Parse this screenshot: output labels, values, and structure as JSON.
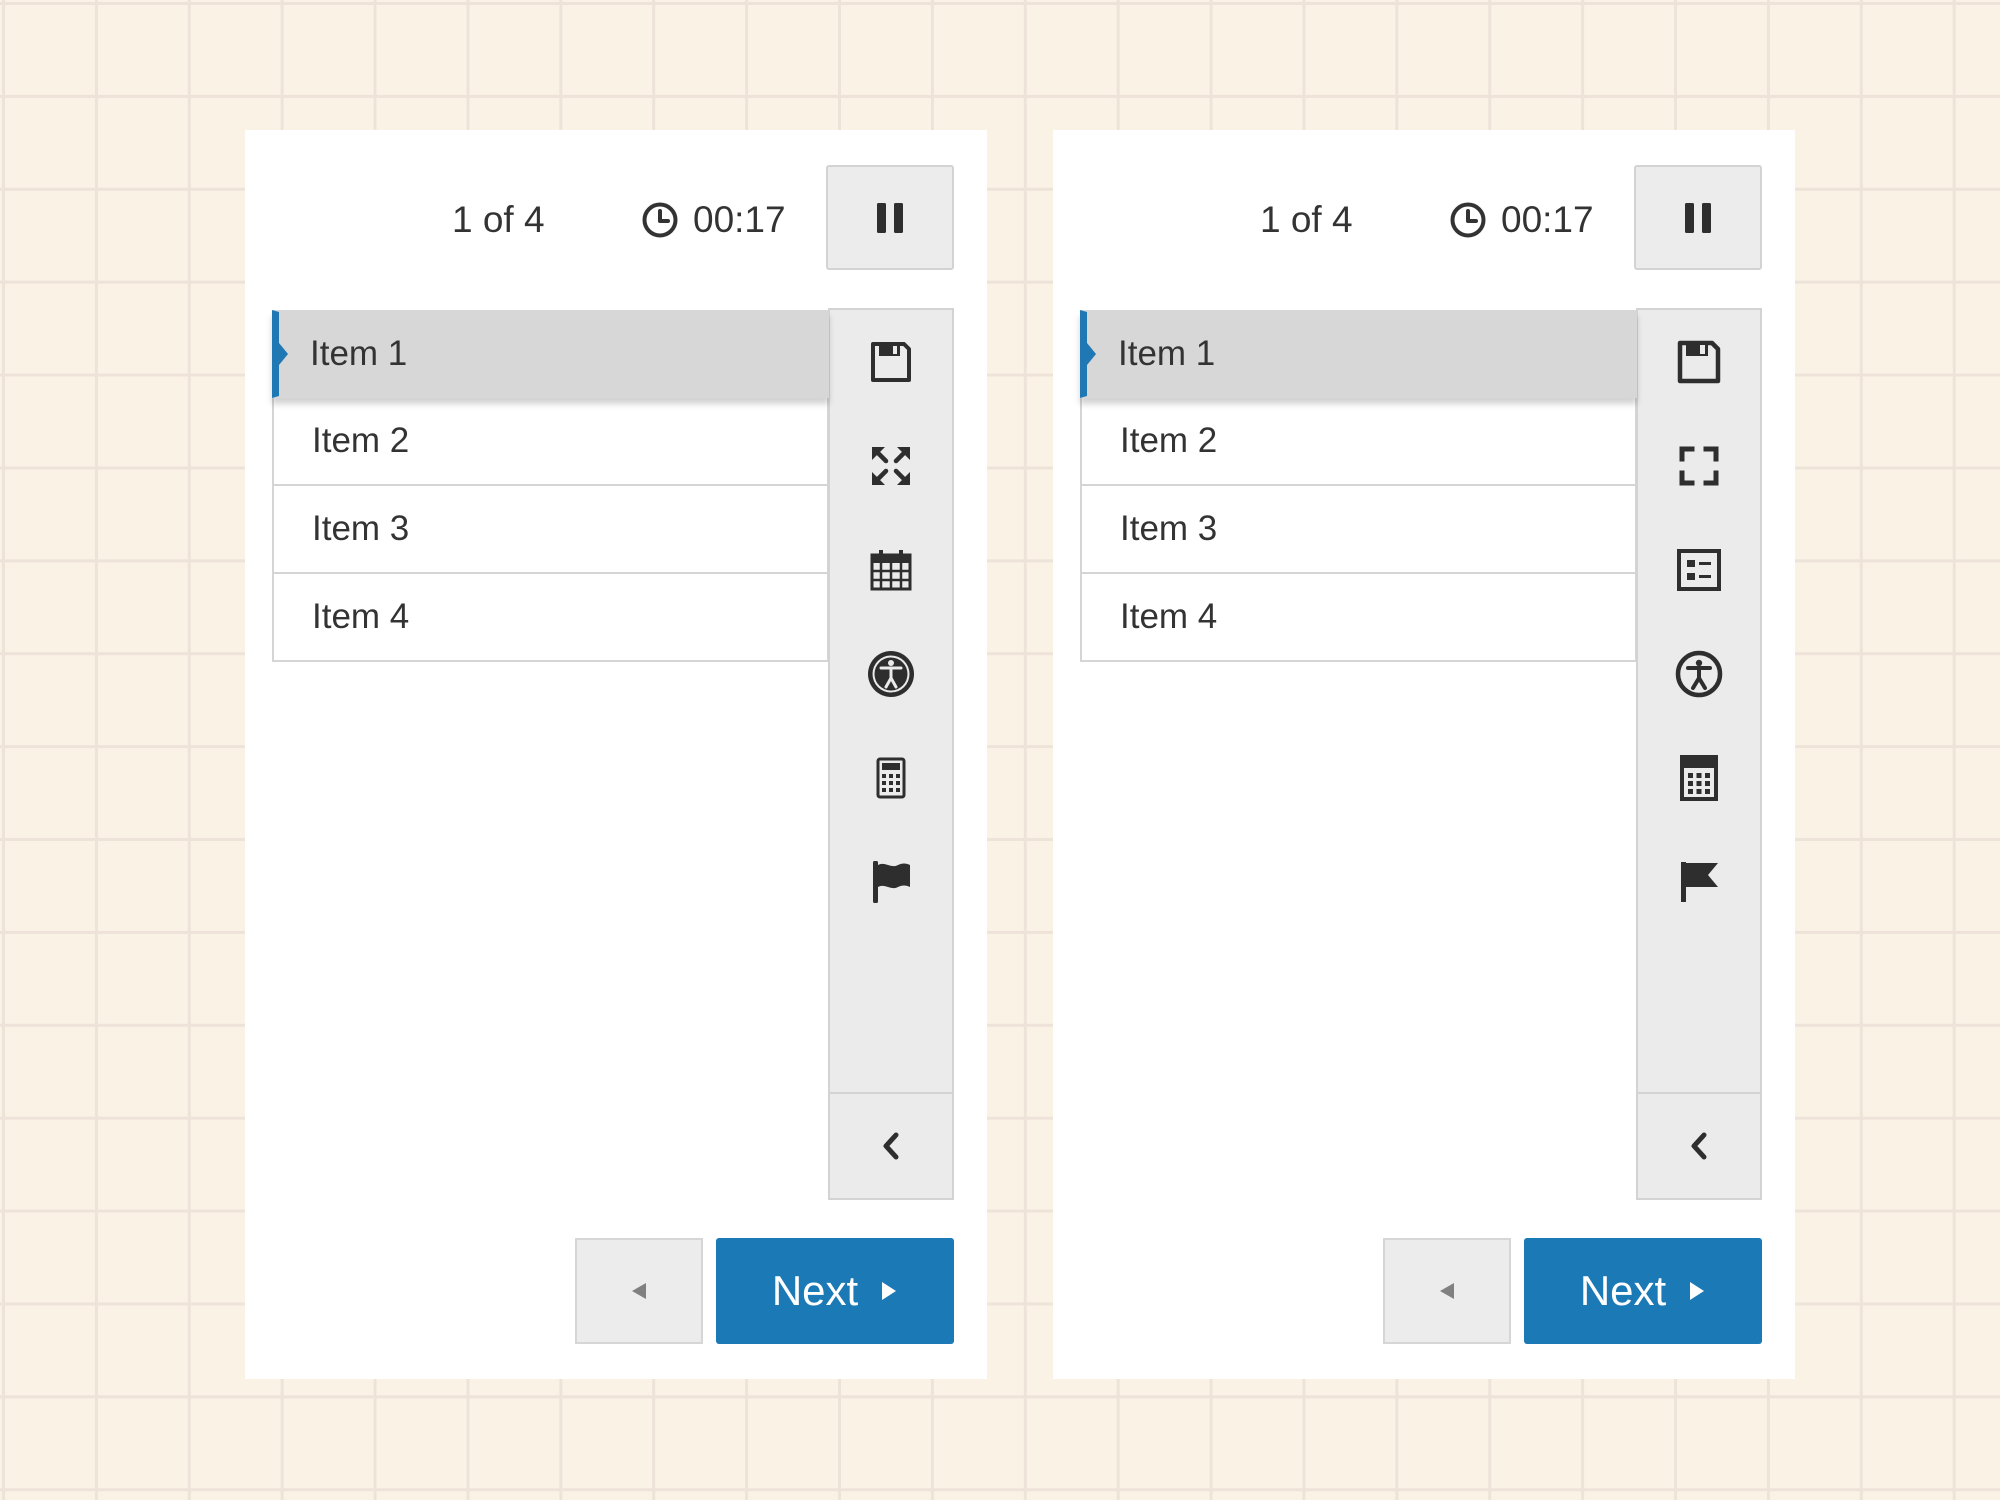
{
  "colors": {
    "accent": "#1b79b6",
    "background": "#fbf2e6",
    "panel": "#ffffff",
    "toolbar": "#ebebeb"
  },
  "panels": [
    {
      "variant": "original",
      "position_label": "1 of 4",
      "timer": "00:17",
      "items": [
        {
          "label": "Item 1",
          "active": true
        },
        {
          "label": "Item 2",
          "active": false
        },
        {
          "label": "Item 3",
          "active": false
        },
        {
          "label": "Item 4",
          "active": false
        }
      ],
      "tools": [
        "save-icon",
        "expand-arrows-icon",
        "calendar-icon",
        "accessibility-icon",
        "calculator-icon",
        "flag-icon"
      ],
      "next_label": "Next"
    },
    {
      "variant": "redesigned",
      "position_label": "1 of 4",
      "timer": "00:17",
      "items": [
        {
          "label": "Item 1",
          "active": true
        },
        {
          "label": "Item 2",
          "active": false
        },
        {
          "label": "Item 3",
          "active": false
        },
        {
          "label": "Item 4",
          "active": false
        }
      ],
      "tools": [
        "save-icon",
        "fullscreen-icon",
        "checklist-icon",
        "accessibility-icon",
        "calculator-icon",
        "flag-icon"
      ],
      "next_label": "Next"
    }
  ]
}
